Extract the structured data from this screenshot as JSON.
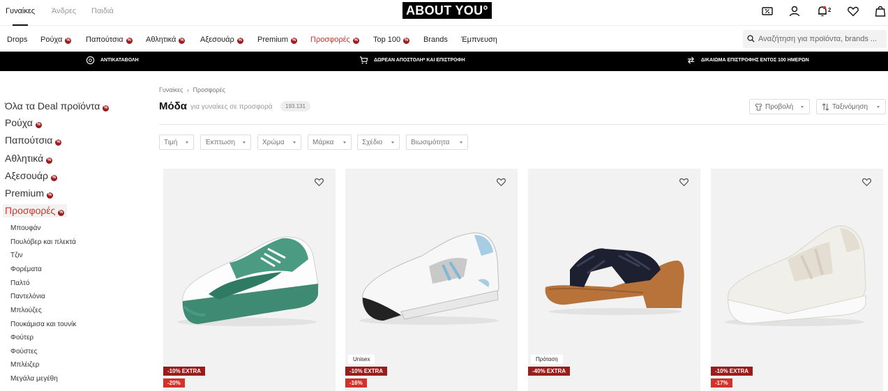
{
  "gender_tabs": [
    "Γυναίκες",
    "Άνδρες",
    "Παιδιά"
  ],
  "logo": "ABOUT YOU°",
  "header_icons": [
    "discount-icon",
    "user-icon",
    "bell-icon",
    "heart-icon",
    "bag-icon"
  ],
  "notifications_count": "2",
  "nav": {
    "items": [
      "Drops",
      "Ρούχα",
      "Παπούτσια",
      "Αθλητικά",
      "Αξεσουάρ",
      "Premium",
      "Προσφορές",
      "Top 100",
      "Brands",
      "Έμπνευση"
    ],
    "search_placeholder": "Αναζήτηση για προϊόντα, brands ..."
  },
  "banner": [
    "ΑΝΤΙΚΑΤΑΒΟΛΗ",
    "ΔΩΡΕΑΝ ΑΠΟΣΤΟΛΗ* ΚΑΙ ΕΠΙΣΤΡΟΦΗ",
    "ΔΙΚΑΙΩΜΑ ΕΠΙΣΤΡΟΦΗΣ ΕΝΤΟΣ 100 ΗΜΕΡΩΝ"
  ],
  "sidebar": {
    "categories": [
      "Όλα τα Deal προϊόντα",
      "Ρούχα",
      "Παπούτσια",
      "Αθλητικά",
      "Αξεσουάρ",
      "Premium",
      "Προσφορές"
    ],
    "subcategories": [
      "Μπουφάν",
      "Πουλόβερ και πλεκτά",
      "Τζιν",
      "Φορέματα",
      "Παλτό",
      "Παντελόνια",
      "Μπλούζες",
      "Πουκάμισα και τουνίκ",
      "Φούτερ",
      "Φούστες",
      "Μπλέιζερ",
      "Μεγάλα μεγέθη"
    ]
  },
  "breadcrumb": {
    "home": "Γυναίκες",
    "current": "Προσφορές"
  },
  "page": {
    "title": "Μόδα",
    "subtitle": "για γυναίκες σε προσφορά",
    "count": "193.131"
  },
  "toolbar": {
    "view": "Προβολή",
    "sort": "Ταξινόμηση"
  },
  "filters": [
    "Τιμή",
    "Έκπτωση",
    "Χρώμα",
    "Μάρκα",
    "Σχέδιο",
    "Βιωσιμότητα"
  ],
  "products": [
    {
      "label": "",
      "tag1": "-10% EXTRA",
      "tag2": "-20%"
    },
    {
      "label": "Unisex",
      "tag1": "-10% EXTRA",
      "tag2": "-16%"
    },
    {
      "label": "Πρόταση",
      "tag1": "-40% EXTRA",
      "tag2": ""
    },
    {
      "label": "",
      "tag1": "-10% EXTRA",
      "tag2": "-17%"
    }
  ],
  "colors": {
    "accent_red": "#d4312a",
    "deal_dark": "#9b1c1c",
    "banner": "#000000",
    "card_bg": "#f2f2f2"
  }
}
